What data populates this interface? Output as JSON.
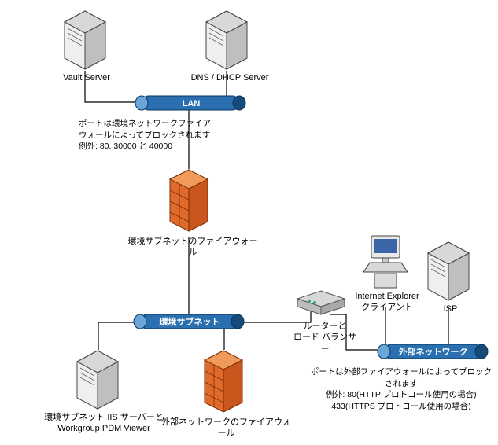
{
  "nodes": {
    "vault": {
      "label": "Vault Server"
    },
    "dns": {
      "label": "DNS / DHCP Server"
    },
    "lan": {
      "label": "LAN"
    },
    "fw_env": {
      "label": "環境サブネットのファイアウォール"
    },
    "env_sub": {
      "label": "環境サブネット"
    },
    "iis": {
      "label": "環境サブネット IIS サーバーと\nWorkgroup PDM Viewer"
    },
    "fw_ext": {
      "label": "外部ネットワークのファイアウォール"
    },
    "router": {
      "label": "ルーターと\nロード バランサー"
    },
    "ie": {
      "label": "Internet Explorer\nクライアント"
    },
    "isp": {
      "label": "ISP"
    },
    "ext_net": {
      "label": "外部ネットワーク"
    }
  },
  "notes": {
    "lan_ports": "ポートは環境ネットワークファイア\nウォールによってブロックされます\n例外: 80, 30000 と 40000",
    "ext_ports": "ポートは外部ファイアウォールによってブロックされます\n例外: 80(HTTP プロトコール使用の場合)\n433(HTTPS プロトコール使用の場合)"
  },
  "chart_data": {
    "type": "network-diagram",
    "nodes": [
      {
        "id": "vault",
        "kind": "server",
        "label": "Vault Server"
      },
      {
        "id": "dns",
        "kind": "server",
        "label": "DNS / DHCP Server"
      },
      {
        "id": "lan",
        "kind": "bus",
        "label": "LAN"
      },
      {
        "id": "fw_env",
        "kind": "firewall",
        "label": "環境サブネットのファイアウォール"
      },
      {
        "id": "env_sub",
        "kind": "bus",
        "label": "環境サブネット"
      },
      {
        "id": "iis",
        "kind": "server",
        "label": "環境サブネット IIS サーバーと Workgroup PDM Viewer"
      },
      {
        "id": "fw_ext",
        "kind": "firewall",
        "label": "外部ネットワークのファイアウォール"
      },
      {
        "id": "router",
        "kind": "router",
        "label": "ルーターと ロード バランサー"
      },
      {
        "id": "ie",
        "kind": "client",
        "label": "Internet Explorer クライアント"
      },
      {
        "id": "isp",
        "kind": "server",
        "label": "ISP"
      },
      {
        "id": "ext_net",
        "kind": "bus",
        "label": "外部ネットワーク"
      }
    ],
    "edges": [
      [
        "vault",
        "lan"
      ],
      [
        "dns",
        "lan"
      ],
      [
        "lan",
        "fw_env"
      ],
      [
        "fw_env",
        "env_sub"
      ],
      [
        "env_sub",
        "iis"
      ],
      [
        "env_sub",
        "fw_ext"
      ],
      [
        "env_sub",
        "router"
      ],
      [
        "router",
        "ext_net"
      ],
      [
        "ie",
        "ext_net"
      ],
      [
        "isp",
        "ext_net"
      ],
      [
        "fw_ext",
        "ext_net"
      ]
    ],
    "annotations": [
      {
        "at": "lan",
        "text": "ポートは環境ネットワークファイアウォールによってブロックされます 例外: 80, 30000 と 40000"
      },
      {
        "at": "ext_net",
        "text": "ポートは外部ファイアウォールによってブロックされます 例外: 80(HTTP プロトコール使用の場合) 433(HTTPS プロトコール使用の場合)"
      }
    ]
  }
}
